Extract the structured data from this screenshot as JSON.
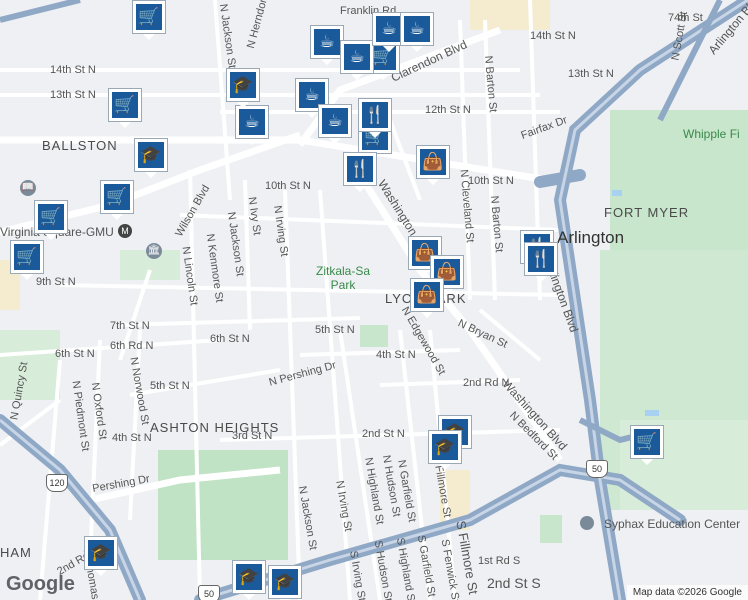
{
  "map": {
    "attribution": "Map data ©2026 Google",
    "logo": "Google",
    "areas": [
      "BALLSTON",
      "FORT MYER",
      "ASHTON HEIGHTS",
      "LYON PARK",
      "HAM"
    ],
    "city": "Arlington",
    "streets": [
      "Franklin Rd",
      "N Herndon St",
      "14th St N",
      "13th St N",
      "12th St N",
      "11th St N",
      "10th St N",
      "9th St N",
      "7th St N",
      "6th St N",
      "6th Rd N",
      "5th St N",
      "4th St N",
      "3rd St N",
      "2nd St N",
      "2nd Rd N",
      "1st Rd S",
      "2nd St S",
      "Wilson Blvd",
      "Washington Blvd",
      "Clarendon Blvd",
      "N Pershing Dr",
      "Pershing Dr",
      "Fairfax Dr",
      "N Quincy St",
      "N Irving St",
      "N Ivy St",
      "N Jackson St",
      "N Kenmore St",
      "N Lincoln St",
      "N Norwood St",
      "N Oxford St",
      "N Piedmont St",
      "N Thomas St",
      "N Edgewood St",
      "N Bryan St",
      "N Garfield St",
      "N Highland St",
      "N Fillmore St",
      "N Cleveland St",
      "N Barton St",
      "N Bedford St",
      "Arlington Blvd",
      "N Scott St",
      "74th St",
      "S Fillmore St",
      "S Irving St",
      "S Hudson St",
      "S Highland St",
      "S Garfield St",
      "S Fenwick St",
      "N Hudson St",
      "Arlington Bl"
    ],
    "parks": [
      "Zitkala-Sa Park",
      "Whipple Fi"
    ],
    "pois": [
      "Virginia Square-GMU",
      "Syphax Education Center",
      "Lyon Park"
    ],
    "shields": [
      "120",
      "50",
      "50"
    ]
  },
  "icons": [
    "cart-icon",
    "coffee-icon",
    "school-icon",
    "restaurant-icon",
    "bag-icon",
    "library-icon",
    "museum-icon",
    "metro-icon"
  ]
}
